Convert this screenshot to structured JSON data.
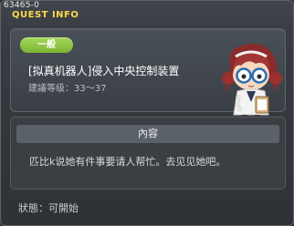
{
  "window": {
    "id_label": "63465-0",
    "title": "QUEST INFO"
  },
  "quest": {
    "category": "一般",
    "name": "[拟真机器人]侵入中央控制装置",
    "level_label": "建議等级：",
    "level_range": "33～37",
    "npc_icon": "npc-scientist-portrait"
  },
  "content": {
    "header": "內容",
    "text": "匹比k说她有件事要请人帮忙。去见见她吧。"
  },
  "status": {
    "label": "狀態：",
    "value": "可開始"
  },
  "colors": {
    "title": "#ffd84a",
    "tag_green": "#8cc63f"
  }
}
